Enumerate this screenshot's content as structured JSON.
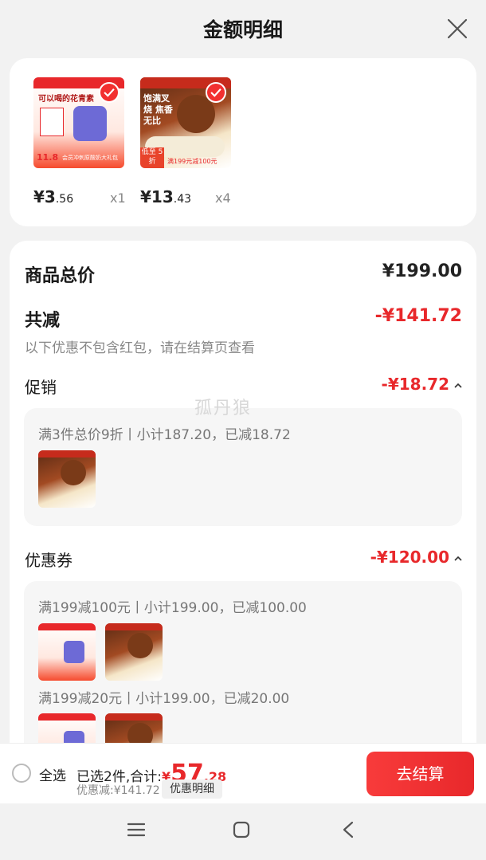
{
  "header": {
    "title": "金额明细"
  },
  "products": [
    {
      "price_main": "¥3",
      "price_decimal": ".56",
      "qty": "x1",
      "thumb_text": "可以喝的花青素",
      "badge": "11.8",
      "banner": "会员冲刺原酸奶大礼包"
    },
    {
      "price_main": "¥13",
      "price_decimal": ".43",
      "qty": "x4",
      "thumb_text": "饱满叉烧 焦香无比",
      "badge": "低至 5折",
      "banner": "满199元减100元"
    }
  ],
  "summary": {
    "total_label": "商品总价",
    "total_value": "¥199.00",
    "reduction_label": "共减",
    "reduction_value": "-¥141.72",
    "reduction_note": "以下优惠不包含红包，请在结算页查看"
  },
  "promotion": {
    "label": "促销",
    "value": "-¥18.72",
    "line": "满3件总价9折丨小计187.20，已减18.72"
  },
  "coupon": {
    "label": "优惠券",
    "value": "-¥120.00",
    "line1": "满199减100元丨小计199.00，已减100.00",
    "line2": "满199减20元丨小计199.00，已减20.00"
  },
  "watermark": "孤丹狼",
  "bottom_bar": {
    "select_all": "全选",
    "selected_prefix": "已选2件,合计:",
    "currency": "¥",
    "total_int": "57",
    "total_dec": ".28",
    "discount_text": "优惠减:¥141.72",
    "detail_button": "优惠明细",
    "checkout_button": "去结算"
  },
  "colors": {
    "accent": "#e8282b",
    "background": "#f2f2f2"
  }
}
